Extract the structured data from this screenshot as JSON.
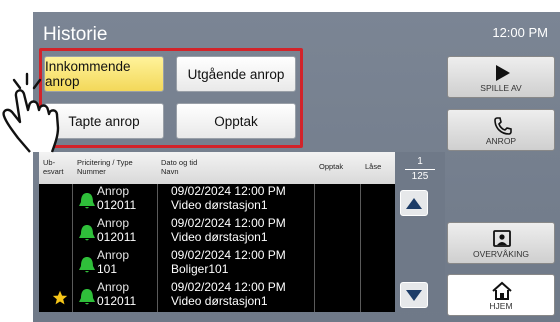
{
  "header": {
    "title": "Historie",
    "time": "12:00 PM"
  },
  "filters": {
    "incoming": "Innkommende anrop",
    "outgoing": "Utgående anrop",
    "missed": "Tapte anrop",
    "recording": "Opptak"
  },
  "table": {
    "headers": {
      "unanswered_1": "Ub-",
      "unanswered_2": "esvart",
      "priority_1": "Pricitering / Type",
      "priority_2": "Nummer",
      "date_1": "Dato og tid",
      "date_2": "Navn",
      "recording": "Opptak",
      "lock": "Låse"
    },
    "rows": [
      {
        "type": "Anrop",
        "number": "012011",
        "datetime": "09/02/2024 12:00 PM",
        "name": "Video dørstasjon1",
        "starred": false
      },
      {
        "type": "Anrop",
        "number": "012011",
        "datetime": "09/02/2024 12:00 PM",
        "name": "Video dørstasjon1",
        "starred": false
      },
      {
        "type": "Anrop",
        "number": "101",
        "datetime": "09/02/2024 12:00 PM",
        "name": "Boliger101",
        "starred": false
      },
      {
        "type": "Anrop",
        "number": "012011",
        "datetime": "09/02/2024 12:00 PM",
        "name": "Video dørstasjon1",
        "starred": true
      }
    ]
  },
  "pager": {
    "current": "1",
    "total": "125"
  },
  "side": {
    "play": "SPILLE AV",
    "call": "ANROP",
    "monitor": "OVERVÅKING",
    "home": "HJEM"
  },
  "colors": {
    "accent_red": "#d2232a",
    "active_yellow": "#f3d85a",
    "bell_green": "#2fbf3a",
    "star_yellow": "#f5c518",
    "screen_gray": "#747e8d"
  },
  "icons": [
    "play-icon",
    "phone-icon",
    "monitor-icon",
    "home-icon",
    "bell-icon",
    "star-icon",
    "arrow-up-icon",
    "arrow-down-icon",
    "pointing-hand-icon"
  ]
}
